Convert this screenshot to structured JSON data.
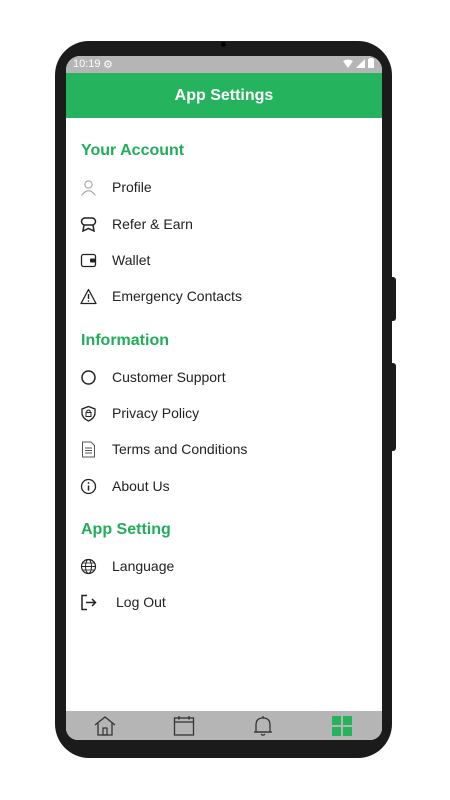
{
  "statusbar": {
    "time": "10:19"
  },
  "header": {
    "title": "App Settings"
  },
  "sections": [
    {
      "title": "Your Account",
      "items": [
        {
          "label": "Profile",
          "icon": "person-icon"
        },
        {
          "label": "Refer & Earn",
          "icon": "gift-icon"
        },
        {
          "label": "Wallet",
          "icon": "wallet-icon"
        },
        {
          "label": "Emergency Contacts",
          "icon": "warning-icon"
        }
      ]
    },
    {
      "title": "Information",
      "items": [
        {
          "label": "Customer Support",
          "icon": "circle-icon"
        },
        {
          "label": "Privacy Policy",
          "icon": "shield-icon"
        },
        {
          "label": "Terms and Conditions",
          "icon": "document-icon"
        },
        {
          "label": "About Us",
          "icon": "info-icon"
        }
      ]
    },
    {
      "title": "App Setting",
      "items": [
        {
          "label": "Language",
          "icon": "globe-icon"
        },
        {
          "label": "Log Out",
          "icon": "logout-icon"
        }
      ]
    }
  ],
  "bottom_nav": [
    {
      "name": "home",
      "icon": "home-icon",
      "active": false
    },
    {
      "name": "calendar",
      "icon": "calendar-icon",
      "active": false
    },
    {
      "name": "notifications",
      "icon": "bell-icon",
      "active": false
    },
    {
      "name": "menu",
      "icon": "grid-icon",
      "active": true
    }
  ],
  "colors": {
    "accent": "#26b35e",
    "section_title": "#21ad5a",
    "status_bar": "#b5b5b5",
    "frame": "#1b1b1b"
  }
}
